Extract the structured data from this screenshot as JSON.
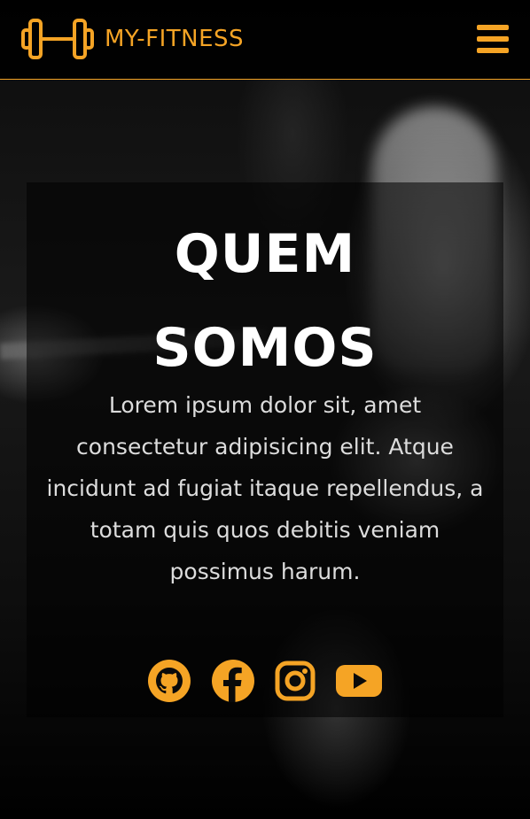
{
  "brand": {
    "name": "MY-FITNESS",
    "logo_icon": "dumbbell-icon",
    "accent_color": "#f5a425"
  },
  "nav": {
    "menu_icon": "hamburger-menu-icon"
  },
  "hero": {
    "title_line1": "QUEM",
    "title_line2": "SOMOS",
    "description": "Lorem ipsum dolor sit, amet consectetur adipisicing elit. Atque incidunt ad fugiat itaque repellendus, a totam quis quos debitis veniam possimus harum."
  },
  "socials": [
    {
      "icon": "github-icon"
    },
    {
      "icon": "facebook-icon"
    },
    {
      "icon": "instagram-icon"
    },
    {
      "icon": "youtube-icon"
    }
  ]
}
